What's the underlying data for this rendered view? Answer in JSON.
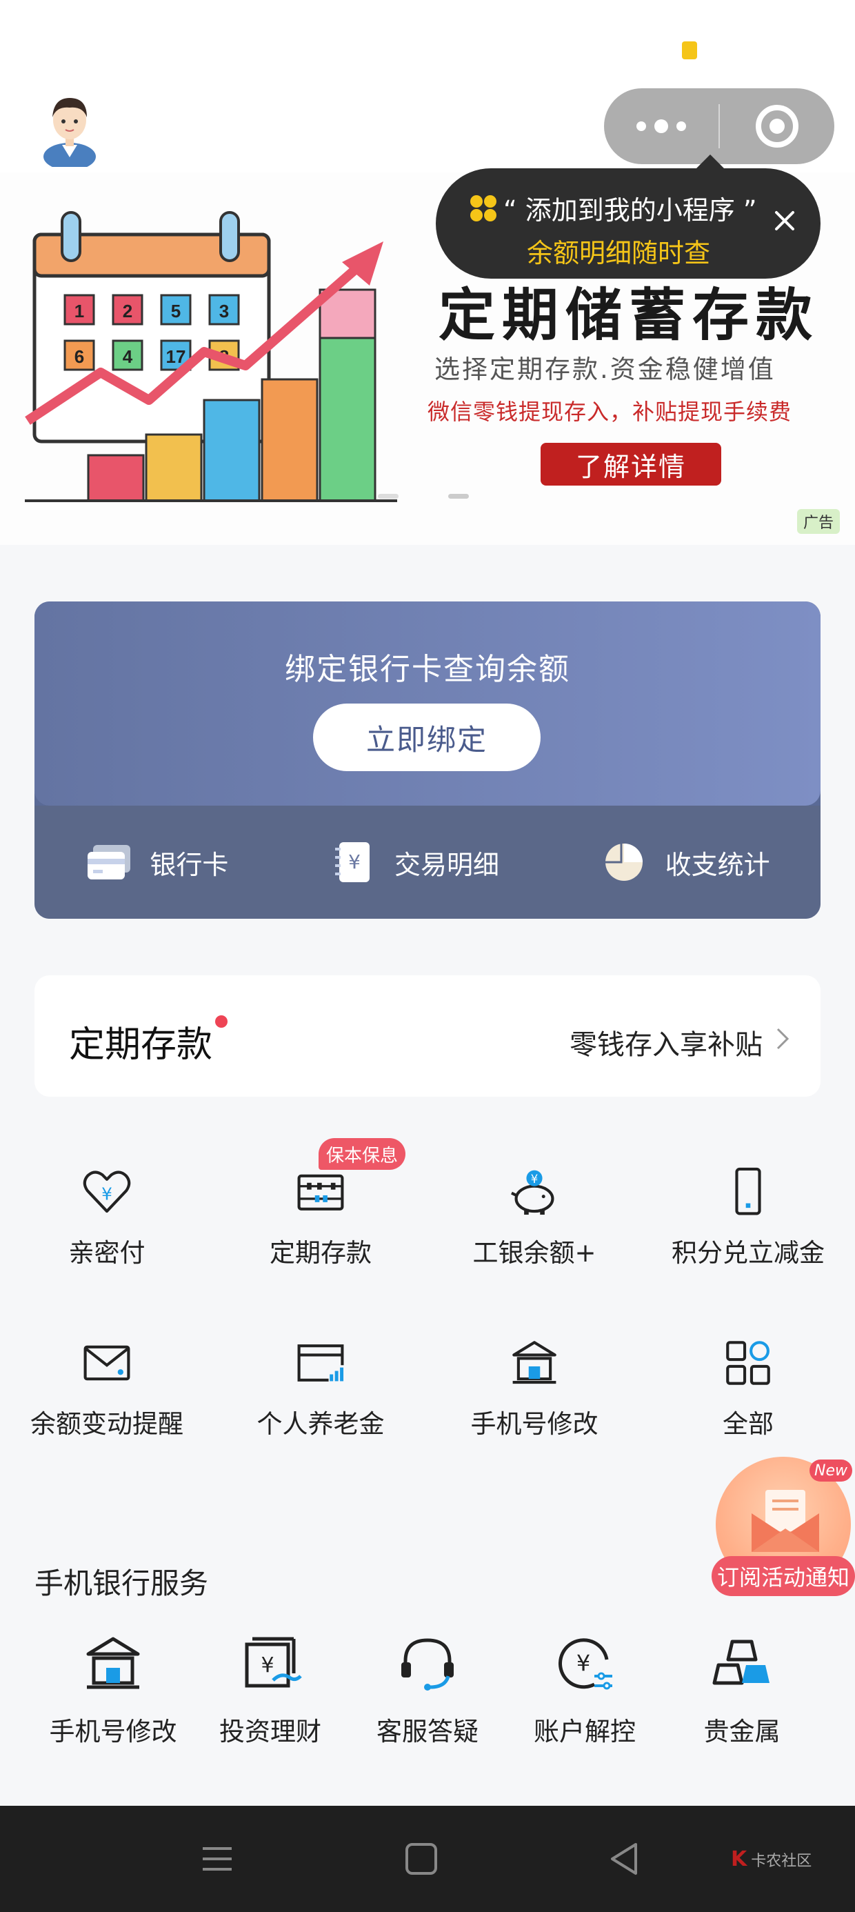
{
  "header": {
    "capsule_menu": "more-icon",
    "capsule_close": "close-miniprogram-icon"
  },
  "banner": {
    "title": "定期储蓄存款",
    "subtitle1": "选择定期存款.资金稳健增值",
    "subtitle2": "微信零钱提现存入，补贴提现手续费",
    "button": "了解详情",
    "calendar_numbers": [
      "1",
      "2",
      "5",
      "3",
      "6",
      "4",
      "17",
      "8"
    ],
    "ad_tag": "广告"
  },
  "tooltip": {
    "line1": "“ 添加到我的小程序 ”",
    "line2": "余额明细随时查"
  },
  "bind_card": {
    "title": "绑定银行卡查询余额",
    "button": "立即绑定",
    "links": [
      {
        "label": "银行卡",
        "icon": "bank-card-icon"
      },
      {
        "label": "交易明细",
        "icon": "transaction-detail-icon"
      },
      {
        "label": "收支统计",
        "icon": "pie-chart-icon"
      }
    ]
  },
  "deposit": {
    "title": "定期存款",
    "right_text": "零钱存入享补贴"
  },
  "grid": {
    "badge": "保本保息",
    "items": [
      {
        "label": "亲密付",
        "icon": "heart-yuan-icon"
      },
      {
        "label": "定期存款",
        "icon": "abacus-icon"
      },
      {
        "label": "工银余额+",
        "icon": "piggy-bank-icon"
      },
      {
        "label": "积分兑立减金",
        "icon": "phone-icon"
      },
      {
        "label": "余额变动提醒",
        "icon": "mail-icon"
      },
      {
        "label": "个人养老金",
        "icon": "card-chart-icon"
      },
      {
        "label": "手机号修改",
        "icon": "bank-building-icon"
      },
      {
        "label": "全部",
        "icon": "grid-all-icon"
      }
    ]
  },
  "float_promo": {
    "new_tag": "New",
    "label": "订阅活动通知"
  },
  "services": {
    "title": "手机银行服务",
    "items": [
      {
        "label": "手机号修改",
        "icon": "bank-building-icon"
      },
      {
        "label": "投资理财",
        "icon": "invest-icon"
      },
      {
        "label": "客服答疑",
        "icon": "headset-icon"
      },
      {
        "label": "账户解控",
        "icon": "account-unlock-icon"
      },
      {
        "label": "贵金属",
        "icon": "gold-bars-icon"
      }
    ]
  },
  "navbar": {
    "watermark": "卡农社区",
    "watermark_logo": "K"
  },
  "colors": {
    "accent_blue": "#1a9be6",
    "card_bg": "#6474a2",
    "badge_red": "#ee5766",
    "tooltip_yellow": "#f5c518"
  }
}
